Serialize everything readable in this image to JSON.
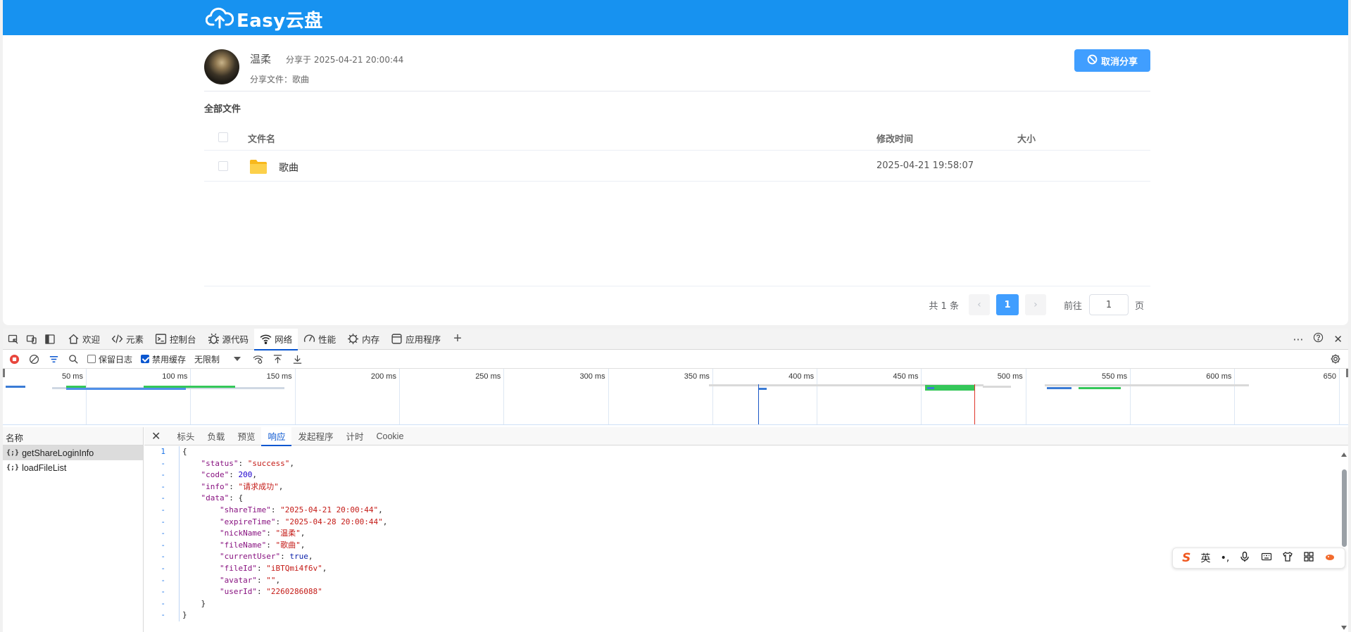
{
  "app": {
    "logo_text": "Easy云盘"
  },
  "share": {
    "nickname": "温柔",
    "share_time_label": "分享于 2025-04-21 20:00:44",
    "share_file_label": "分享文件：歌曲",
    "cancel_button": "取消分享"
  },
  "file_list": {
    "title": "全部文件",
    "columns": {
      "name": "文件名",
      "modified": "修改时间",
      "size": "大小"
    },
    "rows": [
      {
        "name": "歌曲",
        "modified": "2025-04-21 19:58:07",
        "size": ""
      }
    ]
  },
  "pagination": {
    "total": "共 1 条",
    "prev": "‹",
    "current": "1",
    "next": "›",
    "goto_label": "前往",
    "goto_value": "1",
    "unit": "页"
  },
  "devtools": {
    "tabs": [
      {
        "label": "欢迎",
        "icon": "home-icon"
      },
      {
        "label": "元素",
        "icon": "code-icon"
      },
      {
        "label": "控制台",
        "icon": "console-icon"
      },
      {
        "label": "源代码",
        "icon": "bug-icon"
      },
      {
        "label": "网络",
        "icon": "wifi-icon",
        "active": true
      },
      {
        "label": "性能",
        "icon": "gauge-icon"
      },
      {
        "label": "内存",
        "icon": "memory-icon"
      },
      {
        "label": "应用程序",
        "icon": "app-icon"
      }
    ],
    "toolbar": {
      "preserve_log": "保留日志",
      "preserve_log_checked": false,
      "disable_cache": "禁用缓存",
      "disable_cache_checked": true,
      "throttle": "无限制"
    },
    "timeline_labels": [
      "50 ms",
      "100 ms",
      "150 ms",
      "200 ms",
      "250 ms",
      "300 ms",
      "350 ms",
      "400 ms",
      "450 ms",
      "500 ms",
      "550 ms",
      "600 ms",
      "650"
    ],
    "name_header": "名称",
    "requests": [
      {
        "name": "getShareLoginInfo",
        "selected": true
      },
      {
        "name": "loadFileList",
        "selected": false
      }
    ],
    "detail_tabs": [
      {
        "label": "标头"
      },
      {
        "label": "负载"
      },
      {
        "label": "预览"
      },
      {
        "label": "响应",
        "active": true
      },
      {
        "label": "发起程序"
      },
      {
        "label": "计时"
      },
      {
        "label": "Cookie"
      }
    ],
    "response_lines": [
      {
        "ln": "1",
        "text": "{"
      },
      {
        "ln": "-",
        "key": "status",
        "val": "\"success\"",
        "type": "s",
        "indent": 1
      },
      {
        "ln": "-",
        "key": "code",
        "val": "200",
        "type": "n",
        "indent": 1
      },
      {
        "ln": "-",
        "key": "info",
        "val": "\"请求成功\"",
        "type": "s",
        "indent": 1
      },
      {
        "ln": "-",
        "key": "data",
        "val": "{",
        "type": "p",
        "indent": 1
      },
      {
        "ln": "-",
        "key": "shareTime",
        "val": "\"2025-04-21 20:00:44\"",
        "type": "s",
        "indent": 2
      },
      {
        "ln": "-",
        "key": "expireTime",
        "val": "\"2025-04-28 20:00:44\"",
        "type": "s",
        "indent": 2
      },
      {
        "ln": "-",
        "key": "nickName",
        "val": "\"温柔\"",
        "type": "s",
        "indent": 2
      },
      {
        "ln": "-",
        "key": "fileName",
        "val": "\"歌曲\"",
        "type": "s",
        "indent": 2
      },
      {
        "ln": "-",
        "key": "currentUser",
        "val": "true",
        "type": "b",
        "indent": 2
      },
      {
        "ln": "-",
        "key": "fileId",
        "val": "\"iBTQmi4f6v\"",
        "type": "s",
        "indent": 2
      },
      {
        "ln": "-",
        "key": "avatar",
        "val": "\"\"",
        "type": "s",
        "indent": 2
      },
      {
        "ln": "-",
        "key": "userId",
        "val": "\"2260286088\"",
        "type": "s",
        "indent": 2,
        "last": true
      },
      {
        "ln": "-",
        "text": "}",
        "indent": 1
      },
      {
        "ln": "-",
        "text": "}"
      }
    ]
  },
  "ime": {
    "mode": "英",
    "logo": "S"
  },
  "colors": {
    "topbar": "#1792f0",
    "primary": "#409eff",
    "devtools_accent": "#0b57d0"
  }
}
